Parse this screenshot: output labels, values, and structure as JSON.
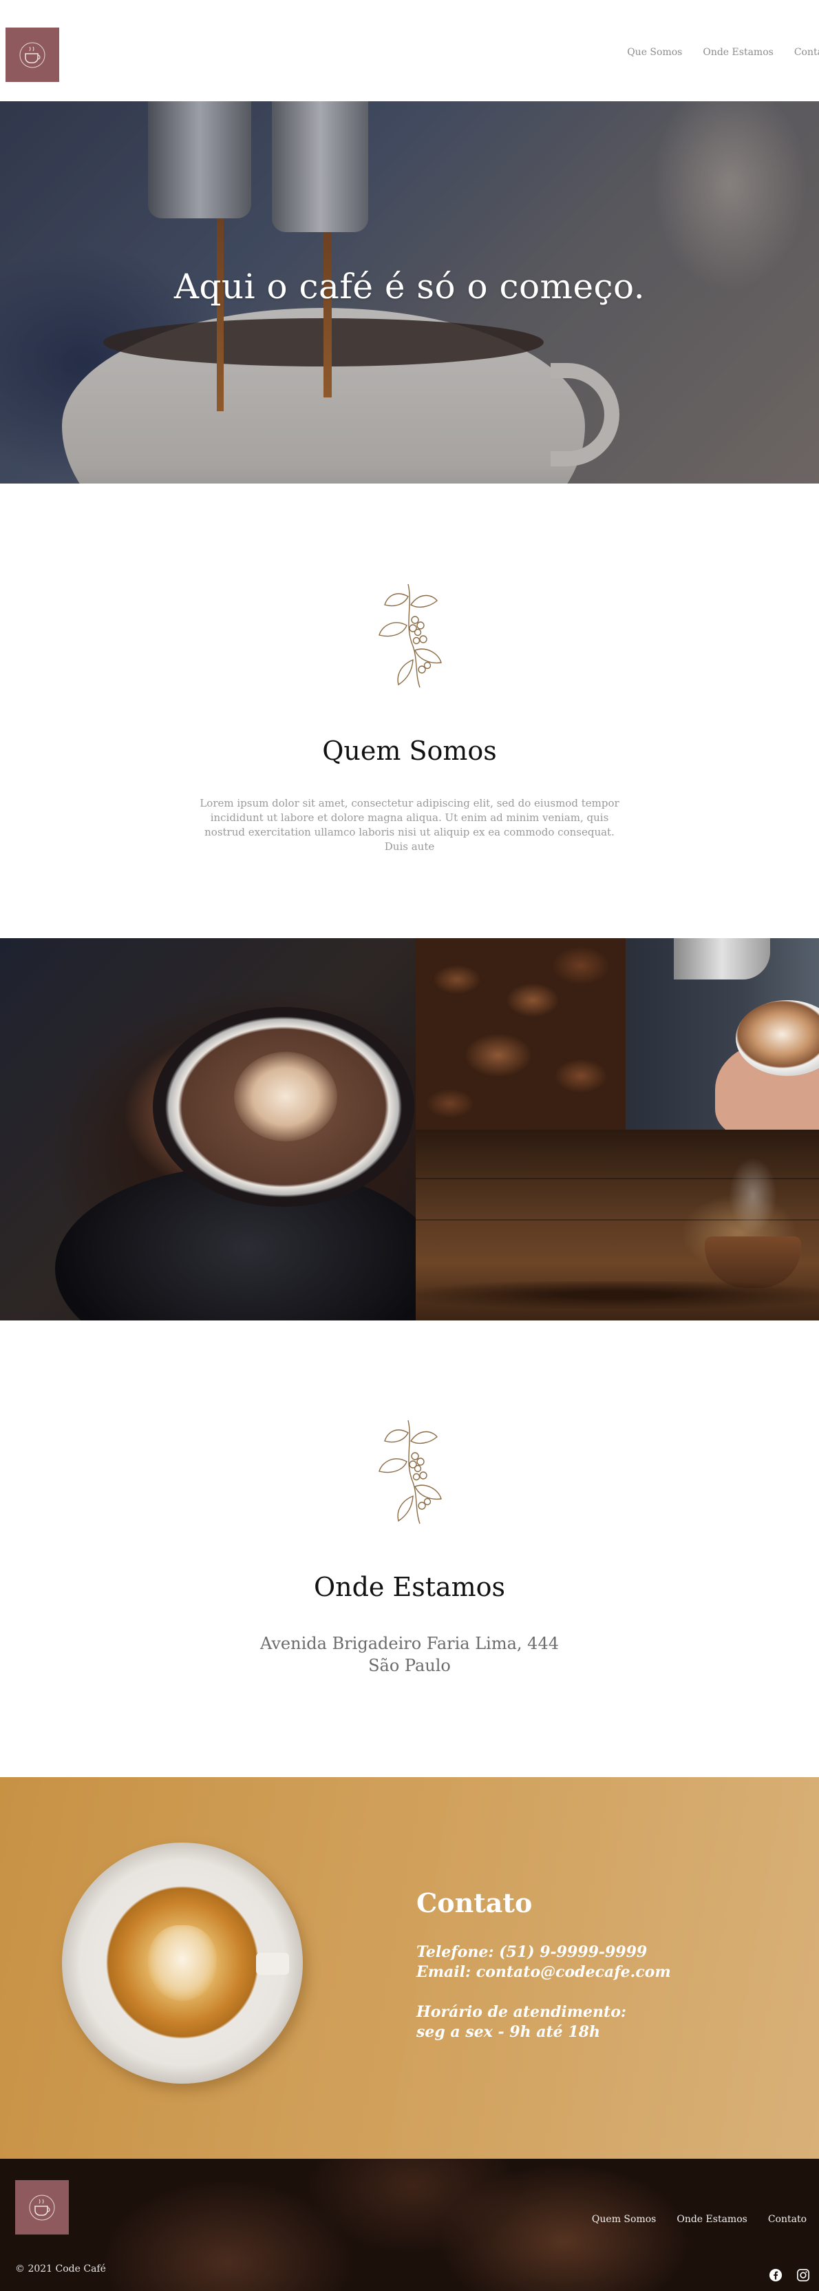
{
  "header": {
    "logo_icon": "code-cafe-logo-icon",
    "nav": [
      "Que Somos",
      "Onde Estamos",
      "Contato"
    ]
  },
  "hero": {
    "title": "Aqui o café é só o começo."
  },
  "about": {
    "icon": "coffee-branch-icon",
    "title": "Quem Somos",
    "text": "Lorem ipsum dolor sit amet, consectetur adipiscing elit, sed do eiusmod tempor incididunt ut labore et dolore magna aliqua. Ut enim ad minim veniam, quis nostrud exercitation ullamco laboris nisi ut aliquip ex ea commodo consequat. Duis aute"
  },
  "location": {
    "icon": "coffee-branch-icon",
    "title": "Onde Estamos",
    "address_line1": "Avenida Brigadeiro Faria Lima, 444",
    "address_line2": "São Paulo"
  },
  "contact": {
    "title": "Contato",
    "phone": "Telefone: (51) 9-9999-9999",
    "email": "Email: contato@codecafe.com",
    "hours_label": "Horário de atendimento:",
    "hours": "seg a sex - 9h até 18h"
  },
  "footer": {
    "nav": [
      "Quem Somos",
      "Onde Estamos",
      "Contato"
    ],
    "copyright": "© 2021 Code Café",
    "social_icons": [
      "facebook-icon",
      "instagram-icon"
    ]
  },
  "colors": {
    "brand": "#8e5a5e",
    "contact_bg": "#d1a15c",
    "footer_bg": "#1c100b"
  }
}
